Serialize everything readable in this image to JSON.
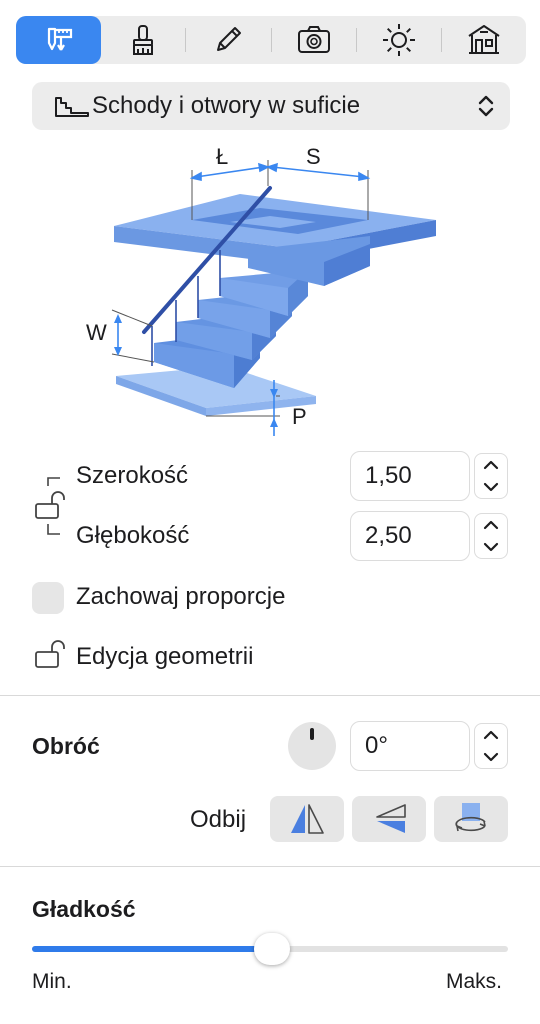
{
  "toolbar": {
    "tools": [
      {
        "name": "measure-tool",
        "icon": "caliper-icon",
        "active": true
      },
      {
        "name": "brush-tool",
        "icon": "brush-icon",
        "active": false
      },
      {
        "name": "pencil-tool",
        "icon": "pencil-icon",
        "active": false
      },
      {
        "name": "camera-tool",
        "icon": "camera-icon",
        "active": false
      },
      {
        "name": "light-tool",
        "icon": "sun-icon",
        "active": false
      },
      {
        "name": "house-tool",
        "icon": "house-icon",
        "active": false
      }
    ],
    "accent": "#3a87f0"
  },
  "dropdown": {
    "label": "Schody i otwory w suficie",
    "icon": "stairs-icon"
  },
  "diagram": {
    "label_width": "Ł",
    "label_depth": "S",
    "label_height": "W",
    "label_floor": "P"
  },
  "dimensions": {
    "width_label": "Szerokość",
    "width_value": "1,50",
    "depth_label": "Głębokość",
    "depth_value": "2,50"
  },
  "options": {
    "keep_proportions": "Zachowaj proporcje",
    "keep_proportions_checked": false,
    "edit_geometry": "Edycja geometrii"
  },
  "rotate": {
    "title": "Obróć",
    "value": "0°",
    "mirror_label": "Odbij"
  },
  "smoothness": {
    "title": "Gładkość",
    "min_label": "Min.",
    "max_label": "Maks.",
    "level": 0.5,
    "fill_color": "#2f7bea"
  }
}
